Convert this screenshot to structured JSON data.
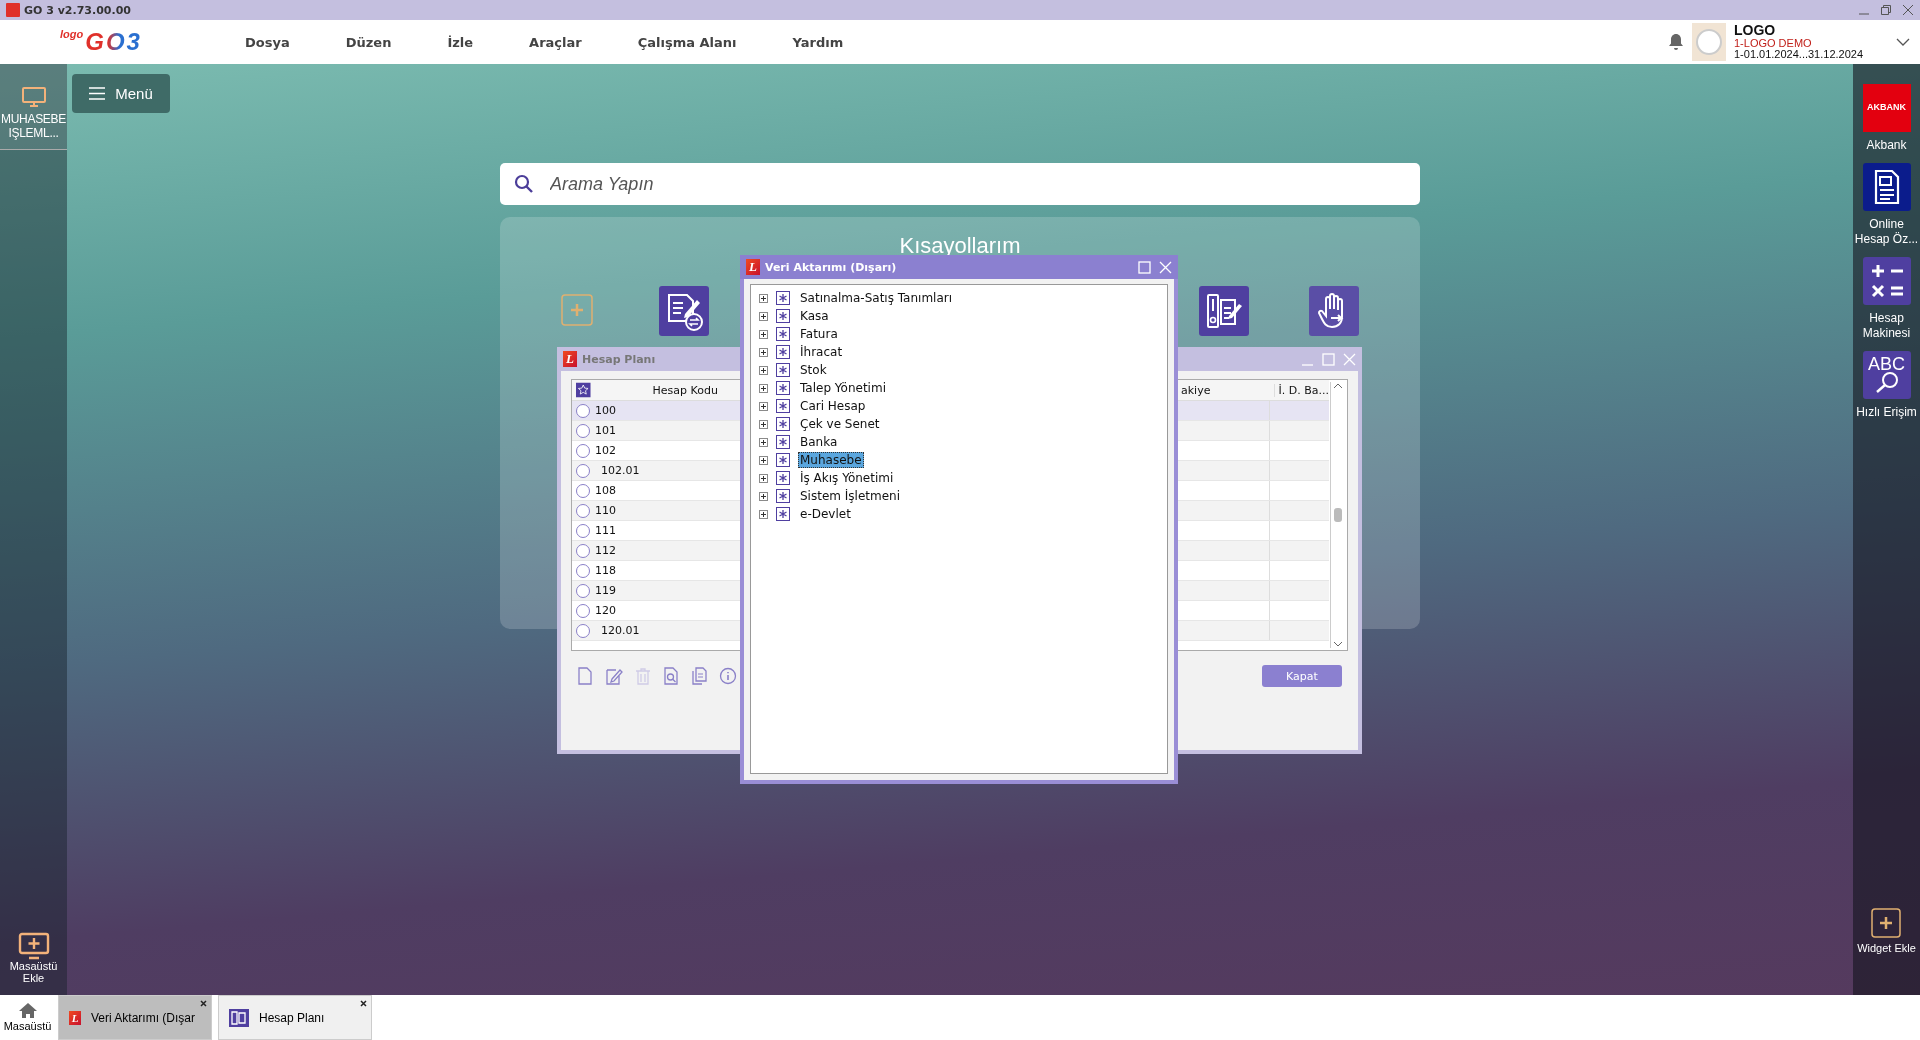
{
  "window": {
    "title": "GO 3 v2.73.00.00"
  },
  "logo": {
    "small": "logo",
    "big": "GO3"
  },
  "menus": [
    "Dosya",
    "Düzen",
    "İzle",
    "Araçlar",
    "Çalışma Alanı",
    "Yardım"
  ],
  "user": {
    "name": "LOGO",
    "company": "1-LOGO DEMO",
    "period": "1-01.01.2024...31.12.2024"
  },
  "left_sidebar": {
    "items": [
      {
        "label": "MUHASEBE IŞLEML...",
        "selected": true
      }
    ],
    "add_label": "Masaüstü Ekle"
  },
  "menu_button": "Menü",
  "search": {
    "placeholder": "Arama Yapın"
  },
  "shortcuts": {
    "title": "Kısayollarım"
  },
  "right_sidebar": {
    "widgets": [
      {
        "kind": "akbank",
        "logo": "AKBANK",
        "label": "Akbank"
      },
      {
        "kind": "statement",
        "label": "Online Hesap Öz..."
      },
      {
        "kind": "calculator",
        "label": "Hesap Makinesi"
      },
      {
        "kind": "abc",
        "logo": "ABC",
        "label": "Hızlı Erişim"
      }
    ],
    "add_label": "Widget Ekle"
  },
  "account_plan_window": {
    "icon_letter": "L",
    "title": "Hesap Planı",
    "columns": [
      "Hesap Kodu",
      "akiye",
      "İ. D. Ba..."
    ],
    "rows": [
      {
        "code": "100",
        "kind": "main",
        "selected": true
      },
      {
        "code": "101",
        "kind": "main",
        "selected": false
      },
      {
        "code": "102",
        "kind": "main",
        "selected": false
      },
      {
        "code": "102.01",
        "kind": "sub",
        "selected": false
      },
      {
        "code": "108",
        "kind": "main",
        "selected": false
      },
      {
        "code": "110",
        "kind": "main",
        "selected": false
      },
      {
        "code": "111",
        "kind": "main",
        "selected": false
      },
      {
        "code": "112",
        "kind": "main",
        "selected": false
      },
      {
        "code": "118",
        "kind": "main",
        "selected": false
      },
      {
        "code": "119",
        "kind": "main",
        "selected": false
      },
      {
        "code": "120",
        "kind": "main",
        "selected": false
      },
      {
        "code": "120.01",
        "kind": "sub",
        "selected": false
      }
    ],
    "close_button": "Kapat"
  },
  "export_window": {
    "icon_letter": "L",
    "title": "Veri Aktarımı (Dışarı)",
    "tree": [
      {
        "label": "Satınalma-Satış Tanımları",
        "expanded": false,
        "selected": false
      },
      {
        "label": "Kasa",
        "expanded": false,
        "selected": false
      },
      {
        "label": "Fatura",
        "expanded": false,
        "selected": false
      },
      {
        "label": "İhracat",
        "expanded": false,
        "selected": false
      },
      {
        "label": "Stok",
        "expanded": false,
        "selected": false
      },
      {
        "label": "Talep Yönetimi",
        "expanded": false,
        "selected": false
      },
      {
        "label": "Cari Hesap",
        "expanded": false,
        "selected": false
      },
      {
        "label": "Çek ve Senet",
        "expanded": false,
        "selected": false
      },
      {
        "label": "Banka",
        "expanded": false,
        "selected": false
      },
      {
        "label": "Muhasebe",
        "expanded": false,
        "selected": true
      },
      {
        "label": "İş Akış Yönetimi",
        "expanded": false,
        "selected": false
      },
      {
        "label": "Sistem İşletmeni",
        "expanded": false,
        "selected": false
      },
      {
        "label": "e-Devlet",
        "expanded": false,
        "selected": false
      }
    ]
  },
  "taskbar": {
    "home": "Masaüstü",
    "tasks": [
      {
        "kind": "export",
        "icon_letter": "L",
        "label": "Veri Aktarımı (Dışar",
        "selected": true
      },
      {
        "kind": "plan",
        "label": "Hesap Planı",
        "selected": false
      }
    ]
  }
}
